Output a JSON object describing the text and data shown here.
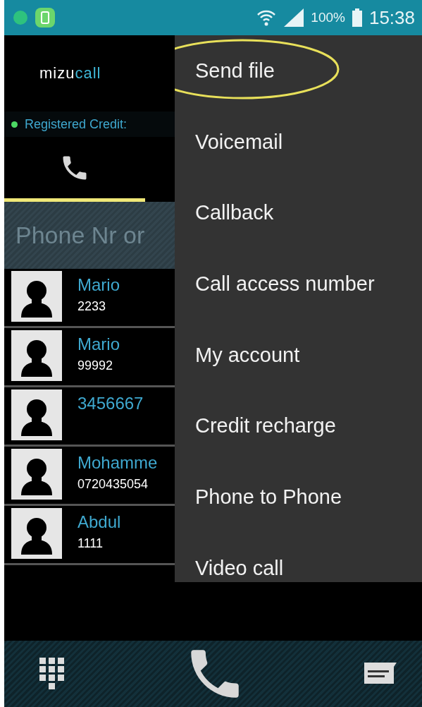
{
  "status_bar": {
    "battery": "100%",
    "time": "15:38"
  },
  "header": {
    "logo": {
      "first": "mizu",
      "second": "call"
    }
  },
  "registration": {
    "text": "Registered Credit:",
    "color": "#4cd964"
  },
  "tabs": [
    {
      "kind": "phone",
      "selected": true
    }
  ],
  "search": {
    "placeholder": "Phone Nr or"
  },
  "contacts": [
    {
      "name": "Mario",
      "number": "2233"
    },
    {
      "name": "Mario",
      "number": "99992"
    },
    {
      "name": "3456667"
    },
    {
      "name": "Mohamme",
      "number": "0720435054"
    },
    {
      "name": "Abdul",
      "number": "1111"
    }
  ],
  "menu": {
    "items": [
      {
        "label": "Send file",
        "highlighted": true
      },
      {
        "label": "Voicemail",
        "highlighted": false
      },
      {
        "label": "Callback",
        "highlighted": false
      },
      {
        "label": "Call access number",
        "highlighted": false
      },
      {
        "label": "My account",
        "highlighted": false
      },
      {
        "label": "Credit recharge",
        "highlighted": false
      },
      {
        "label": "Phone to Phone",
        "highlighted": false
      },
      {
        "label": "Video call",
        "highlighted": false
      }
    ]
  },
  "bottom_bar": {
    "buttons": [
      {
        "kind": "dialpad"
      },
      {
        "kind": "call"
      },
      {
        "kind": "message"
      }
    ]
  }
}
